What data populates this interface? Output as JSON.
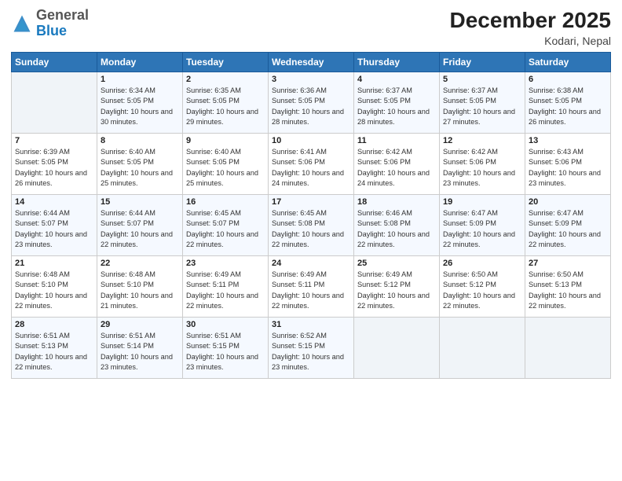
{
  "header": {
    "logo_general": "General",
    "logo_blue": "Blue",
    "month_title": "December 2025",
    "location": "Kodari, Nepal"
  },
  "days_of_week": [
    "Sunday",
    "Monday",
    "Tuesday",
    "Wednesday",
    "Thursday",
    "Friday",
    "Saturday"
  ],
  "weeks": [
    [
      {
        "day": "",
        "info": ""
      },
      {
        "day": "1",
        "info": "Sunrise: 6:34 AM\nSunset: 5:05 PM\nDaylight: 10 hours\nand 30 minutes."
      },
      {
        "day": "2",
        "info": "Sunrise: 6:35 AM\nSunset: 5:05 PM\nDaylight: 10 hours\nand 29 minutes."
      },
      {
        "day": "3",
        "info": "Sunrise: 6:36 AM\nSunset: 5:05 PM\nDaylight: 10 hours\nand 28 minutes."
      },
      {
        "day": "4",
        "info": "Sunrise: 6:37 AM\nSunset: 5:05 PM\nDaylight: 10 hours\nand 28 minutes."
      },
      {
        "day": "5",
        "info": "Sunrise: 6:37 AM\nSunset: 5:05 PM\nDaylight: 10 hours\nand 27 minutes."
      },
      {
        "day": "6",
        "info": "Sunrise: 6:38 AM\nSunset: 5:05 PM\nDaylight: 10 hours\nand 26 minutes."
      }
    ],
    [
      {
        "day": "7",
        "info": "Sunrise: 6:39 AM\nSunset: 5:05 PM\nDaylight: 10 hours\nand 26 minutes."
      },
      {
        "day": "8",
        "info": "Sunrise: 6:40 AM\nSunset: 5:05 PM\nDaylight: 10 hours\nand 25 minutes."
      },
      {
        "day": "9",
        "info": "Sunrise: 6:40 AM\nSunset: 5:05 PM\nDaylight: 10 hours\nand 25 minutes."
      },
      {
        "day": "10",
        "info": "Sunrise: 6:41 AM\nSunset: 5:06 PM\nDaylight: 10 hours\nand 24 minutes."
      },
      {
        "day": "11",
        "info": "Sunrise: 6:42 AM\nSunset: 5:06 PM\nDaylight: 10 hours\nand 24 minutes."
      },
      {
        "day": "12",
        "info": "Sunrise: 6:42 AM\nSunset: 5:06 PM\nDaylight: 10 hours\nand 23 minutes."
      },
      {
        "day": "13",
        "info": "Sunrise: 6:43 AM\nSunset: 5:06 PM\nDaylight: 10 hours\nand 23 minutes."
      }
    ],
    [
      {
        "day": "14",
        "info": "Sunrise: 6:44 AM\nSunset: 5:07 PM\nDaylight: 10 hours\nand 23 minutes."
      },
      {
        "day": "15",
        "info": "Sunrise: 6:44 AM\nSunset: 5:07 PM\nDaylight: 10 hours\nand 22 minutes."
      },
      {
        "day": "16",
        "info": "Sunrise: 6:45 AM\nSunset: 5:07 PM\nDaylight: 10 hours\nand 22 minutes."
      },
      {
        "day": "17",
        "info": "Sunrise: 6:45 AM\nSunset: 5:08 PM\nDaylight: 10 hours\nand 22 minutes."
      },
      {
        "day": "18",
        "info": "Sunrise: 6:46 AM\nSunset: 5:08 PM\nDaylight: 10 hours\nand 22 minutes."
      },
      {
        "day": "19",
        "info": "Sunrise: 6:47 AM\nSunset: 5:09 PM\nDaylight: 10 hours\nand 22 minutes."
      },
      {
        "day": "20",
        "info": "Sunrise: 6:47 AM\nSunset: 5:09 PM\nDaylight: 10 hours\nand 22 minutes."
      }
    ],
    [
      {
        "day": "21",
        "info": "Sunrise: 6:48 AM\nSunset: 5:10 PM\nDaylight: 10 hours\nand 22 minutes."
      },
      {
        "day": "22",
        "info": "Sunrise: 6:48 AM\nSunset: 5:10 PM\nDaylight: 10 hours\nand 21 minutes."
      },
      {
        "day": "23",
        "info": "Sunrise: 6:49 AM\nSunset: 5:11 PM\nDaylight: 10 hours\nand 22 minutes."
      },
      {
        "day": "24",
        "info": "Sunrise: 6:49 AM\nSunset: 5:11 PM\nDaylight: 10 hours\nand 22 minutes."
      },
      {
        "day": "25",
        "info": "Sunrise: 6:49 AM\nSunset: 5:12 PM\nDaylight: 10 hours\nand 22 minutes."
      },
      {
        "day": "26",
        "info": "Sunrise: 6:50 AM\nSunset: 5:12 PM\nDaylight: 10 hours\nand 22 minutes."
      },
      {
        "day": "27",
        "info": "Sunrise: 6:50 AM\nSunset: 5:13 PM\nDaylight: 10 hours\nand 22 minutes."
      }
    ],
    [
      {
        "day": "28",
        "info": "Sunrise: 6:51 AM\nSunset: 5:13 PM\nDaylight: 10 hours\nand 22 minutes."
      },
      {
        "day": "29",
        "info": "Sunrise: 6:51 AM\nSunset: 5:14 PM\nDaylight: 10 hours\nand 23 minutes."
      },
      {
        "day": "30",
        "info": "Sunrise: 6:51 AM\nSunset: 5:15 PM\nDaylight: 10 hours\nand 23 minutes."
      },
      {
        "day": "31",
        "info": "Sunrise: 6:52 AM\nSunset: 5:15 PM\nDaylight: 10 hours\nand 23 minutes."
      },
      {
        "day": "",
        "info": ""
      },
      {
        "day": "",
        "info": ""
      },
      {
        "day": "",
        "info": ""
      }
    ]
  ]
}
